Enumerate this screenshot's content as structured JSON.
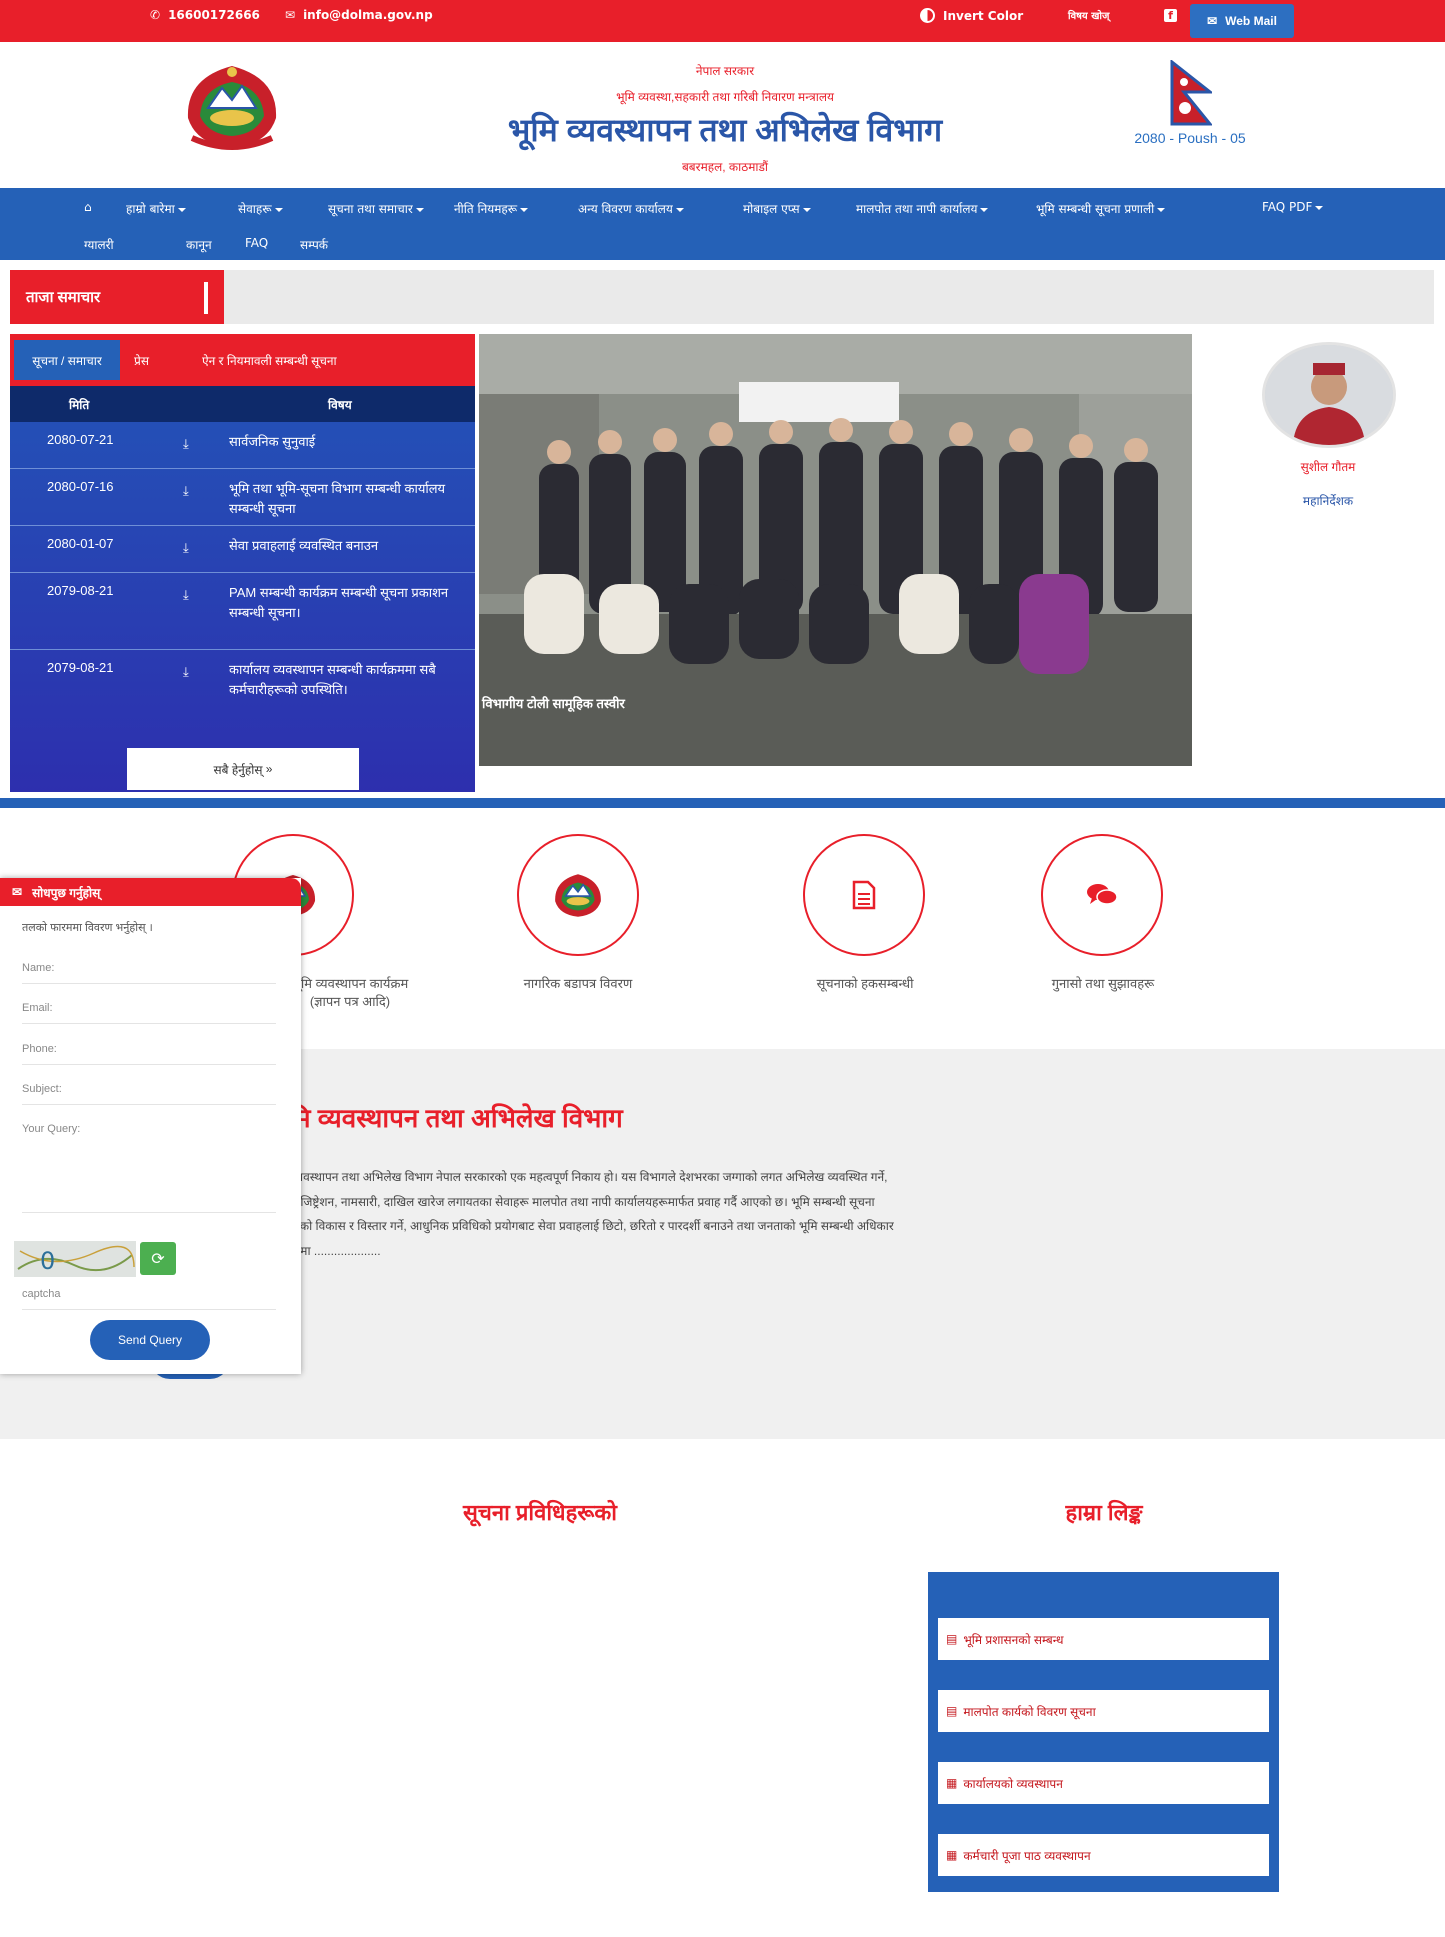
{
  "topbar": {
    "phone": "16600172666",
    "email": "info@dolma.gov.np",
    "invert": "Invert Color",
    "search": "विषय खोज्",
    "webmail": "Web Mail"
  },
  "header": {
    "line1": "नेपाल सरकार",
    "line2": "भूमि व्यवस्था,सहकारी तथा गरिबी निवारण मन्त्रालय",
    "title": "भूमि व्यवस्थापन तथा अभिलेख विभाग",
    "location": "बबरमहल, काठमाडौं",
    "date": "2080 - Poush - 05"
  },
  "nav": {
    "row1": [
      "हाम्रो बारेमा",
      "सेवाहरू",
      "सूचना तथा समाचार",
      "नीति नियमहरू",
      "अन्य विवरण कार्यालय",
      "मोबाइल एप्स",
      "मालपोत तथा नापी कार्यालय",
      "भूमि सम्बन्धी सूचना प्रणाली",
      "FAQ PDF"
    ],
    "row2": [
      "ग्यालरी",
      "कानून",
      "FAQ",
      "सम्पर्क"
    ]
  },
  "ticker": {
    "label": "ताजा समाचार"
  },
  "notice": {
    "tabs": [
      "सूचना / समाचार",
      "प्रेस",
      "ऐन र नियमावली सम्बन्धी सूचना"
    ],
    "col_date": "मिति",
    "col_title": "विषय",
    "rows": [
      {
        "date": "2080-07-21",
        "title": "सार्वजनिक सुनुवाई"
      },
      {
        "date": "2080-07-16",
        "title": "भूमि तथा भूमि-सूचना विभाग सम्बन्धी कार्यालय सम्बन्धी सूचना"
      },
      {
        "date": "2080-01-07",
        "title": "सेवा प्रवाहलाई व्यवस्थित बनाउन"
      },
      {
        "date": "2079-08-21",
        "title": "PAM सम्बन्धी कार्यक्रम सम्बन्धी सूचना प्रकाशन सम्बन्धी सूचना।"
      },
      {
        "date": "2079-08-21",
        "title": "कार्यालय व्यवस्थापन सम्बन्धी कार्यक्रममा सबै कर्मचारीहरूको उपस्थिति।"
      }
    ],
    "more": "सबै हेर्नुहोस्"
  },
  "slider": {
    "caption": "विभागीय टोली सामूहिक तस्वीर"
  },
  "chief": {
    "name": "सुशील गौतम",
    "role": "महानिर्देशक"
  },
  "services": [
    {
      "label": "भूमि व्यवस्थापन कार्यक्रम",
      "sub": "(ज्ञापन पत्र आदि)"
    },
    {
      "label": "नागरिक बडापत्र विवरण",
      "sub": ""
    },
    {
      "label": "सूचनाको हकसम्बन्धी",
      "sub": ""
    },
    {
      "label": "गुनासो तथा सुझावहरू",
      "sub": ""
    }
  ],
  "about": {
    "heading": "भूमि व्यवस्थापन तथा अभिलेख विभाग",
    "text": "भूमि व्यवस्थापन तथा अभिलेख विभाग नेपाल सरकारको एक महत्वपूर्ण निकाय हो। यस विभागले देशभरका जग्गाको लगत अभिलेख व्यवस्थित गर्ने, जग्गा रजिष्ट्रेशन, नामसारी, दाखिल खारेज लगायतका सेवाहरू मालपोत तथा नापी कार्यालयहरूमार्फत प्रवाह गर्दै आएको छ। भूमि सम्बन्धी सूचना प्रणालीको विकास र विस्तार गर्ने, आधुनिक प्रविधिको प्रयोगबाट सेवा प्रवाहलाई छिटो, छरितो र पारदर्शी बनाउने तथा जनताको भूमि सम्बन्धी अधिकार संरक्षणमा ...................."
  },
  "query": {
    "title": "सोधपुछ गर्नुहोस्",
    "intro": "तलको फारममा विवरण भर्नुहोस् ।",
    "name_ph": "Name:",
    "email_ph": "Email:",
    "phone_ph": "Phone:",
    "subject_ph": "Subject:",
    "query_ph": "Your Query:",
    "captcha_ph": "captcha",
    "send": "Send Query"
  },
  "bottom": {
    "left_heading": "सूचना प्रविधिहरूको",
    "right_heading": "हाम्रा लिङ्क",
    "links": [
      "भूमि प्रशासनको सम्बन्ध",
      "मालपोत कार्यको विवरण सूचना",
      "कार्यालयको व्यवस्थापन",
      "कर्मचारी पूजा पाठ व्यवस्थापन"
    ]
  }
}
